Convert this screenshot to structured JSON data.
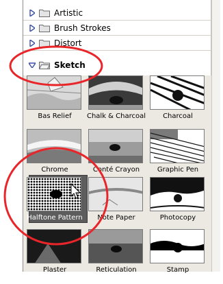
{
  "categories": [
    {
      "label": "Artistic",
      "expanded": false
    },
    {
      "label": "Brush Strokes",
      "expanded": false
    },
    {
      "label": "Distort",
      "expanded": false
    },
    {
      "label": "Sketch",
      "expanded": true
    }
  ],
  "filters": [
    {
      "label": "Bas Relief"
    },
    {
      "label": "Chalk & Charcoal"
    },
    {
      "label": "Charcoal"
    },
    {
      "label": "Chrome"
    },
    {
      "label": "Conté Crayon"
    },
    {
      "label": "Graphic Pen"
    },
    {
      "label": "Halftone Pattern",
      "selected": true
    },
    {
      "label": "Note Paper"
    },
    {
      "label": "Photocopy"
    },
    {
      "label": "Plaster"
    },
    {
      "label": "Reticulation"
    },
    {
      "label": "Stamp"
    }
  ],
  "colors": {
    "annotation": "#e8262a",
    "selected_bg": "#5d5d5d",
    "panel_bg": "#ece9e3",
    "triangle": "#3a4fa8"
  },
  "icons": {
    "collapsed": "triangle-right-icon",
    "expanded": "triangle-down-icon",
    "folder": "folder-icon",
    "cursor": "arrow-cursor-icon"
  }
}
